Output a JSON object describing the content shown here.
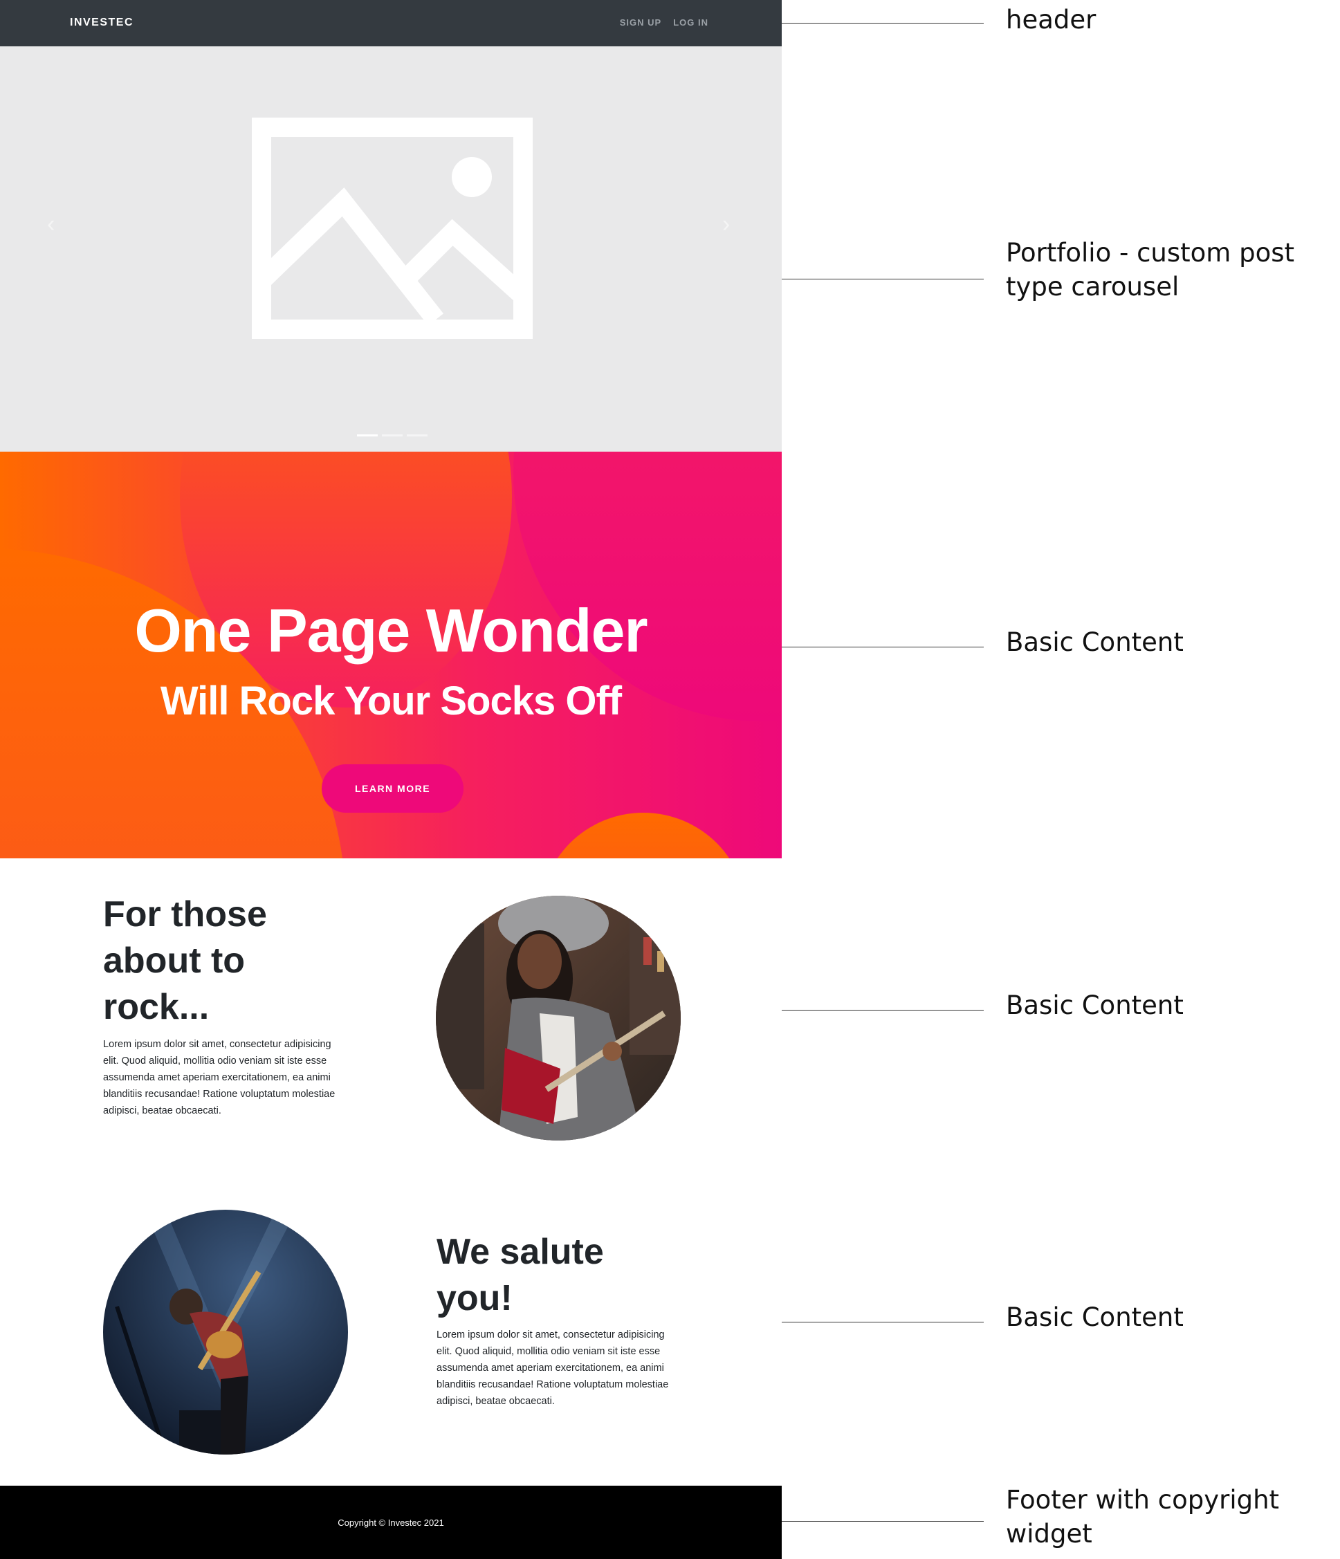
{
  "header": {
    "brand": "INVESTEC",
    "nav": [
      "SIGN UP",
      "LOG IN"
    ]
  },
  "carousel": {
    "prev_icon": "chevron-left-icon",
    "next_icon": "chevron-right-icon",
    "placeholder_icon": "image-placeholder-icon",
    "slide_count": 3,
    "active_slide": 1
  },
  "hero": {
    "title": "One Page Wonder",
    "subtitle": "Will Rock Your Socks Off",
    "button": "LEARN MORE",
    "colors": {
      "orange": "#ff6a00",
      "pink": "#ee0979"
    }
  },
  "sections": [
    {
      "title": "For those about to rock...",
      "body": "Lorem ipsum dolor sit amet, consectetur adipisicing elit. Quod aliquid, mollitia odio veniam sit iste esse assumenda amet aperiam exercitationem, ea animi blanditiis recusandae! Ratione voluptatum molestiae adipisci, beatae obcaecati.",
      "image": "guitarist-woman-photo"
    },
    {
      "title": "We salute you!",
      "body": "Lorem ipsum dolor sit amet, consectetur adipisicing elit. Quod aliquid, mollitia odio veniam sit iste esse assumenda amet aperiam exercitationem, ea animi blanditiis recusandae! Ratione voluptatum molestiae adipisci, beatae obcaecati.",
      "image": "concert-guitarist-photo"
    }
  ],
  "footer": {
    "copyright": "Copyright © Investec 2021"
  },
  "annotations": [
    "header",
    "Portfolio - custom post type carousel",
    "Basic Content",
    "Basic Content",
    "Basic Content",
    "Footer with copyright widget"
  ]
}
